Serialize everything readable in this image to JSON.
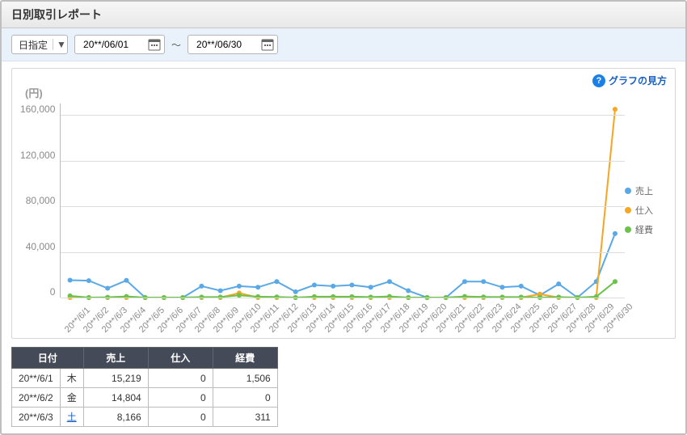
{
  "header": {
    "title": "日別取引レポート"
  },
  "filter": {
    "mode_label": "日指定",
    "date_from": "20**/06/01",
    "date_to": "20**/06/30",
    "separator": "～"
  },
  "help": {
    "label": "グラフの見方"
  },
  "chart_data": {
    "type": "line",
    "title": "",
    "ylabel": "(円)",
    "xlabel": "",
    "ylim": [
      0,
      170000
    ],
    "y_ticks": [
      0,
      40000,
      80000,
      120000,
      160000
    ],
    "y_tick_labels": [
      "0",
      "40,000",
      "80,000",
      "120,000",
      "160,000"
    ],
    "categories": [
      "20**/6/1",
      "20**/6/2",
      "20**/6/3",
      "20**/6/4",
      "20**/6/5",
      "20**/6/6",
      "20**/6/7",
      "20**/6/8",
      "20**/6/9",
      "20**/6/10",
      "20**/6/11",
      "20**/6/12",
      "20**/6/13",
      "20**/6/14",
      "20**/6/15",
      "20**/6/16",
      "20**/6/17",
      "20**/6/18",
      "20**/6/19",
      "20**/6/20",
      "20**/6/21",
      "20**/6/22",
      "20**/6/23",
      "20**/6/24",
      "20**/6/25",
      "20**/6/26",
      "20**/6/27",
      "20**/6/28",
      "20**/6/29",
      "20**/6/30"
    ],
    "series": [
      {
        "name": "売上",
        "color": "#5aa9e6",
        "values": [
          15219,
          14804,
          8166,
          15000,
          0,
          0,
          0,
          10000,
          6000,
          10000,
          9000,
          14000,
          5000,
          11000,
          10000,
          11000,
          9000,
          14000,
          6000,
          0,
          0,
          14000,
          14000,
          9000,
          10000,
          2000,
          12000,
          0,
          14000,
          56000
        ]
      },
      {
        "name": "仕入",
        "color": "#f5a623",
        "values": [
          0,
          0,
          0,
          0,
          0,
          0,
          0,
          0,
          0,
          4000,
          0,
          0,
          0,
          0,
          0,
          0,
          0,
          0,
          0,
          0,
          0,
          0,
          0,
          0,
          0,
          3000,
          0,
          0,
          0,
          165000
        ]
      },
      {
        "name": "経費",
        "color": "#6cc24a",
        "values": [
          1506,
          0,
          311,
          1000,
          0,
          0,
          0,
          400,
          400,
          2000,
          800,
          500,
          0,
          800,
          800,
          800,
          400,
          1000,
          0,
          0,
          0,
          1000,
          600,
          400,
          400,
          0,
          400,
          0,
          800,
          14000
        ]
      }
    ],
    "legend_position": "right"
  },
  "table": {
    "headers": [
      "日付",
      "売上",
      "仕入",
      "経費"
    ],
    "rows": [
      {
        "date": "20**/6/1",
        "dow": "木",
        "sales": "15,219",
        "purchase": "0",
        "expense": "1,506"
      },
      {
        "date": "20**/6/2",
        "dow": "金",
        "sales": "14,804",
        "purchase": "0",
        "expense": "0"
      },
      {
        "date": "20**/6/3",
        "dow": "土",
        "sales": "8,166",
        "purchase": "0",
        "expense": "311",
        "dow_class": "sat"
      }
    ]
  }
}
